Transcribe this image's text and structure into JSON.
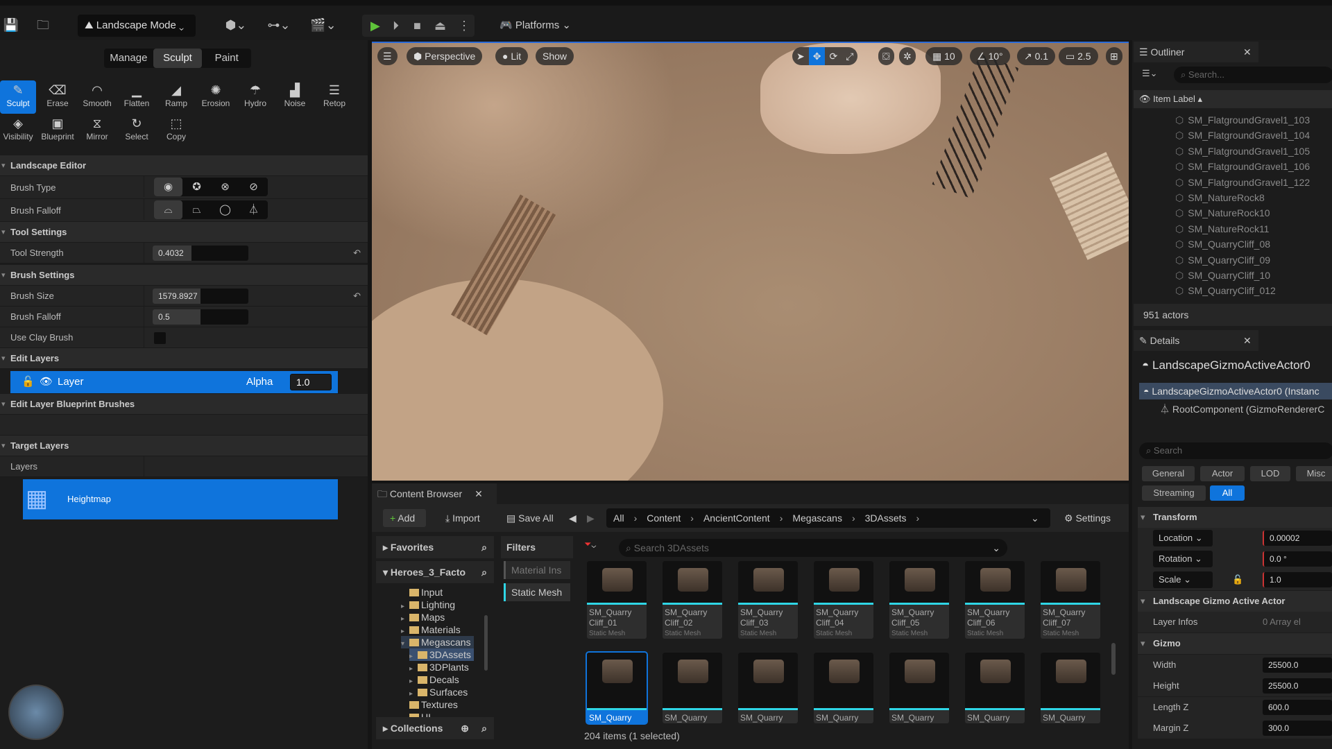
{
  "toolbar": {
    "mode": "Landscape Mode",
    "platforms": "Platforms"
  },
  "mode_tabs": [
    "Manage",
    "Sculpt",
    "Paint"
  ],
  "tools_row1": [
    {
      "label": "Sculpt",
      "icon": "sculpt-icon",
      "glyph": "✎"
    },
    {
      "label": "Erase",
      "icon": "erase-icon",
      "glyph": "⌫"
    },
    {
      "label": "Smooth",
      "icon": "smooth-icon",
      "glyph": "◠"
    },
    {
      "label": "Flatten",
      "icon": "flatten-icon",
      "glyph": "▁"
    },
    {
      "label": "Ramp",
      "icon": "ramp-icon",
      "glyph": "◢"
    },
    {
      "label": "Erosion",
      "icon": "erosion-icon",
      "glyph": "✺"
    },
    {
      "label": "Hydro",
      "icon": "hydro-icon",
      "glyph": "☂"
    },
    {
      "label": "Noise",
      "icon": "noise-icon",
      "glyph": "▟"
    },
    {
      "label": "Retop",
      "icon": "retop-icon",
      "glyph": "☰"
    }
  ],
  "tools_row2": [
    {
      "label": "Visibility",
      "icon": "visibility-icon",
      "glyph": "◈"
    },
    {
      "label": "Blueprint",
      "icon": "blueprint-icon",
      "glyph": "▣"
    },
    {
      "label": "Mirror",
      "icon": "mirror-icon",
      "glyph": "⧖"
    },
    {
      "label": "Select",
      "icon": "select-icon",
      "glyph": "↻"
    },
    {
      "label": "Copy",
      "icon": "copy-icon",
      "glyph": "⬚"
    }
  ],
  "left": {
    "landscape_editor": "Landscape Editor",
    "brush_type": "Brush Type",
    "brush_falloff": "Brush Falloff",
    "tool_settings": "Tool Settings",
    "tool_strength": "Tool Strength",
    "tool_strength_value": "0.4032",
    "tool_strength_fraction": 0.4032,
    "brush_settings": "Brush Settings",
    "brush_size": "Brush Size",
    "brush_size_value": "1579.8927",
    "brush_size_fraction": 0.5,
    "brush_falloff2": "Brush Falloff",
    "brush_falloff_value": "0.5",
    "brush_falloff_fraction": 0.5,
    "use_clay": "Use Clay Brush",
    "use_clay_checked": false,
    "edit_layers": "Edit Layers",
    "layer_name": "Layer",
    "alpha_label": "Alpha",
    "alpha_value": "1.0",
    "bp_brushes": "Edit Layer Blueprint Brushes",
    "target_layers": "Target Layers",
    "layers": "Layers",
    "heightmap": "Heightmap"
  },
  "viewport": {
    "perspective": "Perspective",
    "lit": "Lit",
    "show": "Show",
    "grid": "10",
    "angle": "10°",
    "scale": "0.1",
    "camera": "2.5"
  },
  "content_browser": {
    "tab": "Content Browser",
    "add": "Add",
    "import": "Import",
    "save_all": "Save All",
    "breadcrumb": [
      "All",
      "Content",
      "AncientContent",
      "Megascans",
      "3DAssets"
    ],
    "settings": "Settings",
    "favorites": "Favorites",
    "project": "Heroes_3_Facto",
    "filters": "Filters",
    "filter_items": [
      "Material Ins",
      "Static Mesh"
    ],
    "search_placeholder": "Search 3DAssets",
    "folders": [
      {
        "name": "Input",
        "indent": 1,
        "arrow": false
      },
      {
        "name": "Lighting",
        "indent": 1,
        "arrow": true
      },
      {
        "name": "Maps",
        "indent": 1,
        "arrow": true
      },
      {
        "name": "Materials",
        "indent": 1,
        "arrow": true
      },
      {
        "name": "Megascans",
        "indent": 1,
        "arrow": true,
        "open": true
      },
      {
        "name": "3DAssets",
        "indent": 2,
        "arrow": true,
        "selected": true
      },
      {
        "name": "3DPlants",
        "indent": 2,
        "arrow": true
      },
      {
        "name": "Decals",
        "indent": 2,
        "arrow": true
      },
      {
        "name": "Surfaces",
        "indent": 2,
        "arrow": true
      },
      {
        "name": "Textures",
        "indent": 1,
        "arrow": false
      },
      {
        "name": "UI",
        "indent": 1,
        "arrow": true
      }
    ],
    "assets": [
      {
        "name": "SM_Quarry Cliff_01",
        "type": "Static Mesh"
      },
      {
        "name": "SM_Quarry Cliff_02",
        "type": "Static Mesh"
      },
      {
        "name": "SM_Quarry Cliff_03",
        "type": "Static Mesh"
      },
      {
        "name": "SM_Quarry Cliff_04",
        "type": "Static Mesh"
      },
      {
        "name": "SM_Quarry Cliff_05",
        "type": "Static Mesh"
      },
      {
        "name": "SM_Quarry Cliff_06",
        "type": "Static Mesh"
      },
      {
        "name": "SM_Quarry Cliff_07",
        "type": "Static Mesh"
      }
    ],
    "assets_row2": [
      "SM_Quarry",
      "SM_Quarry",
      "SM_Quarry",
      "SM_Quarry",
      "SM_Quarry",
      "SM_Quarry",
      "SM_Quarry"
    ],
    "collections": "Collections",
    "status": "204 items (1 selected)"
  },
  "outliner": {
    "tab": "Outliner",
    "search_placeholder": "Search...",
    "column": "Item Label",
    "items": [
      "SM_FlatgroundGravel1_103",
      "SM_FlatgroundGravel1_104",
      "SM_FlatgroundGravel1_105",
      "SM_FlatgroundGravel1_106",
      "SM_FlatgroundGravel1_122",
      "SM_NatureRock8",
      "SM_NatureRock10",
      "SM_NatureRock11",
      "SM_QuarryCliff_08",
      "SM_QuarryCliff_09",
      "SM_QuarryCliff_10",
      "SM_QuarryCliff_012"
    ],
    "count": "951 actors"
  },
  "details": {
    "tab": "Details",
    "actor": "LandscapeGizmoActiveActor0",
    "instance": "LandscapeGizmoActiveActor0 (Instanc",
    "root": "RootComponent (GizmoRendererC",
    "search_placeholder": "Search",
    "tabs": [
      "General",
      "Actor",
      "LOD",
      "Misc",
      "Streaming",
      "All"
    ],
    "transform": "Transform",
    "location": "Location",
    "location_value": "0.00002",
    "rotation": "Rotation",
    "rotation_value": "0.0 °",
    "scale": "Scale",
    "scale_value": "1.0",
    "lgaa": "Landscape Gizmo Active Actor",
    "layer_infos": "Layer Infos",
    "layer_infos_value": "0 Array el",
    "gizmo": "Gizmo",
    "width": "Width",
    "width_value": "25500.0",
    "height": "Height",
    "height_value": "25500.0",
    "length_z": "Length Z",
    "length_z_value": "600.0",
    "margin_z": "Margin Z",
    "margin_z_value": "300.0"
  },
  "colors": {
    "accent": "#0f74dc",
    "asset_bar": "#2fd6e6",
    "play": "#5fc43a"
  }
}
